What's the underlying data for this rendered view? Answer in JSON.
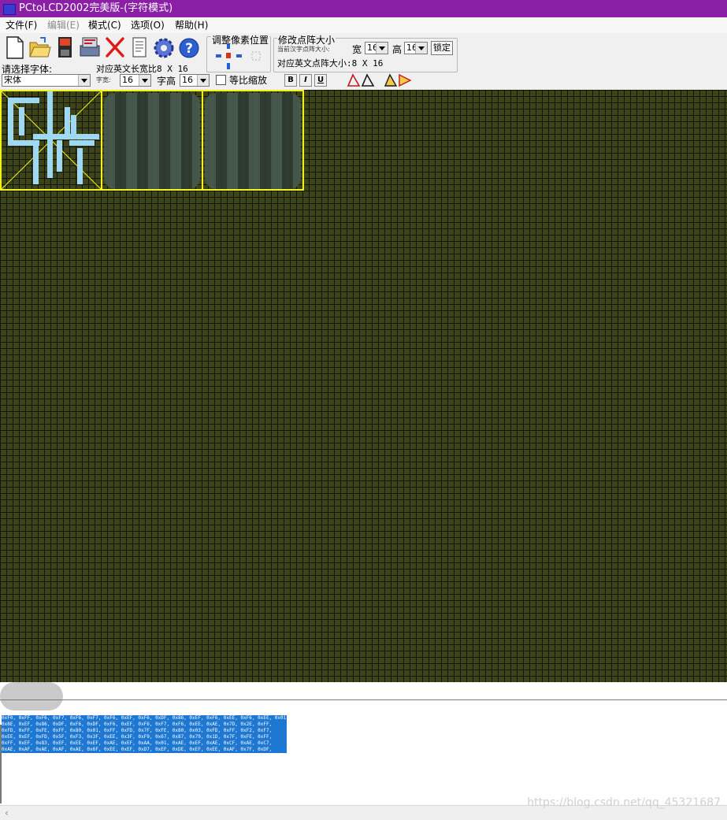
{
  "window": {
    "title": "PCtoLCD2002完美版-(字符模式)"
  },
  "menu": {
    "items": [
      {
        "label": "文件(F)",
        "disabled": false
      },
      {
        "label": "编辑(E)",
        "disabled": true
      },
      {
        "label": "模式(C)",
        "disabled": false
      },
      {
        "label": "选项(O)",
        "disabled": false
      },
      {
        "label": "帮助(H)",
        "disabled": false
      }
    ]
  },
  "toolbar": {
    "icons": [
      "new-file-icon",
      "open-folder-icon",
      "save-disk-icon",
      "generate-data-icon",
      "delete-icon",
      "notepad-icon",
      "settings-gear-icon",
      "help-question-icon"
    ],
    "adjust_pixel_label": "调整像素位置",
    "resize": {
      "group_label": "修改点阵大小",
      "current_size_label": "当前汉字点阵大小:",
      "width_label": "宽",
      "width_value": "16",
      "height_label": "高",
      "height_value": "16",
      "lock_label": "锁定",
      "en_size_label": "对应英文点阵大小:8 X 16"
    },
    "font": {
      "prompt": "请选择字体:",
      "value": "宋体",
      "en_width_ratio": "对应英文长宽比8 X 16",
      "char_width_label": "字宽:",
      "char_width_value": "16",
      "char_height_label": "字高",
      "char_height_value": "16",
      "proportional_label": "等比缩放",
      "bold_label": "B",
      "italic_label": "I",
      "underline_label": "U"
    }
  },
  "output": {
    "hex_lines": [
      "0xF0, 0xFF, 0xF6, 0xF7, 0xF6, 0xF7, 0xF6, 0xEF, 0xF6, 0xDF, 0x86, 0xEF, 0xF6, 0xEE, 0xF6, 0xEE, 0x01,",
      "0x8E, 0xEF, 0x86, 0xDF, 0xF6, 0xDF, 0xF6, 0xEF, 0xF6, 0xF7, 0xF6, 0xEE, 0xAE, 0x7D, 0x2E, 0xFF,",
      "0xFD, 0xFF, 0xFE, 0xFF, 0x80, 0x01, 0xFF, 0xFD, 0x7F, 0xFE, 0x80, 0x03, 0xFD, 0xFF, 0xF2, 0xF7,",
      "0xEE, 0xEF, 0xFD, 0x5F, 0xF3, 0x3F, 0xEE, 0x3F, 0xF9, 0x67, 0x87, 0x79, 0x1D, 0x7F, 0xFE, 0xFF,",
      "0xFF, 0xEF, 0x83, 0xEF, 0xEE, 0xEF, 0xAE, 0xEF, 0xAA, 0x01, 0xAE, 0xEF, 0xAE, 0xCF, 0xAE, 0xC7,",
      "0xAE, 0xAF, 0xAE, 0xAF, 0xAE, 0x6F, 0xEE, 0xEF, 0xD7, 0xEF, 0xDE, 0xEF, 0xEE, 0xAF, 0x7F, 0xDF,"
    ],
    "watermark": "https://blog.csdn.net/qq_45321687"
  }
}
